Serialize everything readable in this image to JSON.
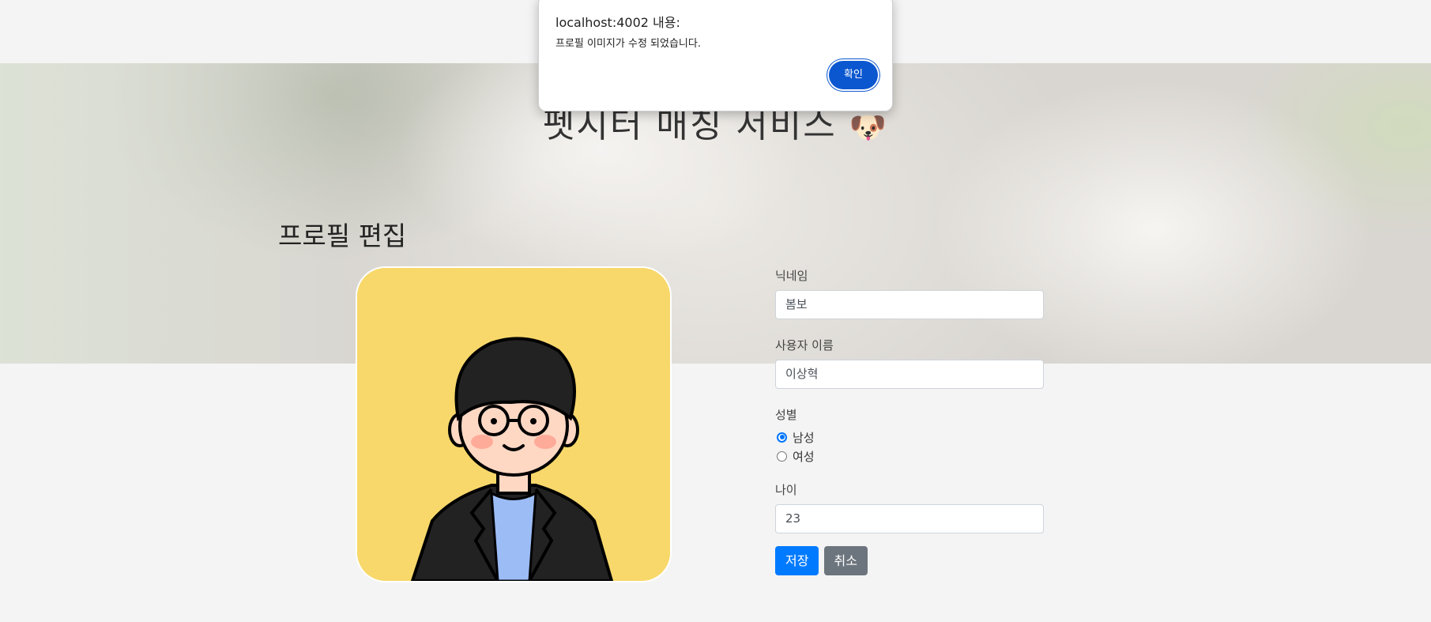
{
  "header": {
    "site_title": "펫시터 매칭 서비스",
    "title_icon": "dog-face-icon"
  },
  "page": {
    "heading": "프로필 편집"
  },
  "profile_form": {
    "nickname_label": "닉네임",
    "nickname_value": "봄보",
    "username_label": "사용자 이름",
    "username_value": "이상혁",
    "gender_label": "성별",
    "gender_options": [
      "남성",
      "여성"
    ],
    "gender_selected": "남성",
    "age_label": "나이",
    "age_value": "23",
    "save_label": "저장",
    "cancel_label": "취소"
  },
  "alert_dialog": {
    "origin": "localhost:4002 내용:",
    "message": "프로필 이미지가 수정 되었습니다.",
    "ok_label": "확인"
  },
  "colors": {
    "primary_button": "#007bff",
    "secondary_button": "#6c757d",
    "avatar_background": "#f8d86a",
    "dialog_ok": "#0b57d0"
  }
}
